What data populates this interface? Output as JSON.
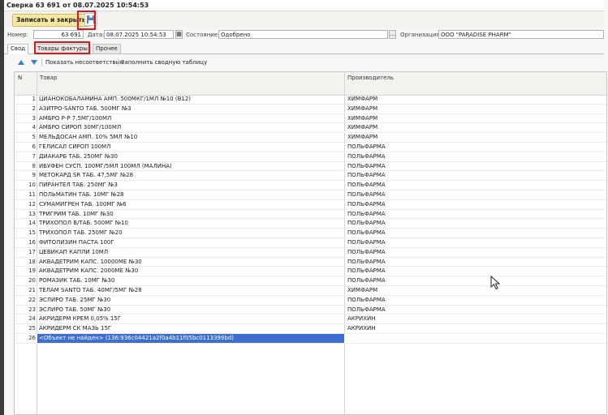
{
  "window": {
    "title": "Сверка 63 691 от 08.07.2025 10:54:53"
  },
  "toolbar": {
    "save_close_label": "Записать и закрыть"
  },
  "fields": {
    "number_label": "Номер:",
    "number_value": "63 691",
    "date_label": "Дата:",
    "date_value": "08.07.2025 10:54:53",
    "state_label": "Состояние:",
    "state_value": "Одобрено",
    "state_btn": "...",
    "org_label": "Организация:",
    "org_value": "ООО \"PARADISE PHARM\""
  },
  "tabs": [
    {
      "label": "Свод"
    },
    {
      "label": "Товары фактуры"
    },
    {
      "label": "Прочее"
    }
  ],
  "subtoolbar": {
    "show_mismatch": "Показать несоответствия",
    "fill_table": "Заполнить сводную таблицу"
  },
  "table": {
    "columns": [
      "N",
      "Товар",
      "Производитель"
    ],
    "rows": [
      {
        "n": "1",
        "name": "ЦИАНОКОБАЛАМИНА АМП. 500МКГ/1МЛ №10 (B12)",
        "mfr": "ХИМФАРМ"
      },
      {
        "n": "2",
        "name": "АЗИТРО-SANTO ТАБ. 500МГ №3",
        "mfr": "ХИМФАРМ"
      },
      {
        "n": "3",
        "name": "АМБРО Р-Р 7,5МГ/100МЛ",
        "mfr": "ХИМФАРМ"
      },
      {
        "n": "4",
        "name": "АМБРО СИРОП 30МГ/100МЛ",
        "mfr": "ХИМФАРМ"
      },
      {
        "n": "5",
        "name": "МЕЛЬДОСАН АМП. 10% 5МЛ №10",
        "mfr": "ХИМФАРМ"
      },
      {
        "n": "6",
        "name": "ГЕЛИСАЛ СИРОП 100МЛ",
        "mfr": "ПОЛЬФАРМА"
      },
      {
        "n": "7",
        "name": "ДИАКАРБ ТАБ. 250МГ №30",
        "mfr": "ПОЛЬФАРМА"
      },
      {
        "n": "8",
        "name": "ИБУФЕН СУСП. 100МГ/5МЛ 100МЛ (МАЛИНА)",
        "mfr": "ПОЛЬФАРМА"
      },
      {
        "n": "9",
        "name": "МЕТОКАРД SR ТАБ. 47,5МГ №28",
        "mfr": "ПОЛЬФАРМА"
      },
      {
        "n": "10",
        "name": "ПИРАНТЕЛ ТАБ. 250МГ №3",
        "mfr": "ПОЛЬФАРМА"
      },
      {
        "n": "11",
        "name": "ПОЛЬМАТИН ТАБ. 10МГ №28",
        "mfr": "ПОЛЬФАРМА"
      },
      {
        "n": "12",
        "name": "СУМАМИГРЕН ТАБ. 100МГ №6",
        "mfr": "ПОЛЬФАРМА"
      },
      {
        "n": "13",
        "name": "ТРИГРИМ ТАБ. 10МГ №30",
        "mfr": "ПОЛЬФАРМА"
      },
      {
        "n": "14",
        "name": "ТРИХОПОЛ В/ТАБ. 500МГ №10",
        "mfr": "ПОЛЬФАРМА"
      },
      {
        "n": "15",
        "name": "ТРИХОПОЛ ТАБ. 250МГ №20",
        "mfr": "ПОЛЬФАРМА"
      },
      {
        "n": "16",
        "name": "ФИТОЛИЗИН ПАСТА 100Г",
        "mfr": "ПОЛЬФАРМА"
      },
      {
        "n": "17",
        "name": "ЦЕВИКАП КАПЛИ 10МЛ",
        "mfr": "ПОЛЬФАРМА"
      },
      {
        "n": "18",
        "name": "АКВАДЕТРИМ КАПС. 10000МЕ №30",
        "mfr": "ПОЛЬФАРМА"
      },
      {
        "n": "19",
        "name": "АКВАДЕТРИМ КАПС. 2000МЕ №30",
        "mfr": "ПОЛЬФАРМА"
      },
      {
        "n": "20",
        "name": "РОМАЗИК ТАБ. 10МГ №30",
        "mfr": "ПОЛЬФАРМА"
      },
      {
        "n": "21",
        "name": "ТЕЛАМ SANTO ТАБ. 40МГ/5МГ №28",
        "mfr": "ХИМФАРМ"
      },
      {
        "n": "22",
        "name": "ЭСЛИРО ТАБ. 25МГ №30",
        "mfr": "ПОЛЬФАРМА"
      },
      {
        "n": "23",
        "name": "ЭСЛИРО ТАБ. 50МГ №30",
        "mfr": "ПОЛЬФАРМА"
      },
      {
        "n": "24",
        "name": "АКРИДЕРМ КРЕМ 0,05% 15Г",
        "mfr": "АКРИХИН"
      },
      {
        "n": "25",
        "name": "АКРИДЕРМ СК МАЗЬ 15Г",
        "mfr": "АКРИХИН"
      },
      {
        "n": "26",
        "name": "<Объект не найден> (136:936c04421a2f0a4b11f05bc0113399bd)",
        "mfr": ""
      }
    ]
  },
  "icons": {
    "save": "floppy-disk-icon",
    "move_up": "arrow-up-icon",
    "move_down": "arrow-down-icon",
    "calendar": "calendar-icon",
    "cursor": "mouse-cursor-icon"
  },
  "colors": {
    "highlight_box": "#e3141e",
    "selected_row": "#3e6fcf",
    "save_button": "#f5e7a0"
  }
}
